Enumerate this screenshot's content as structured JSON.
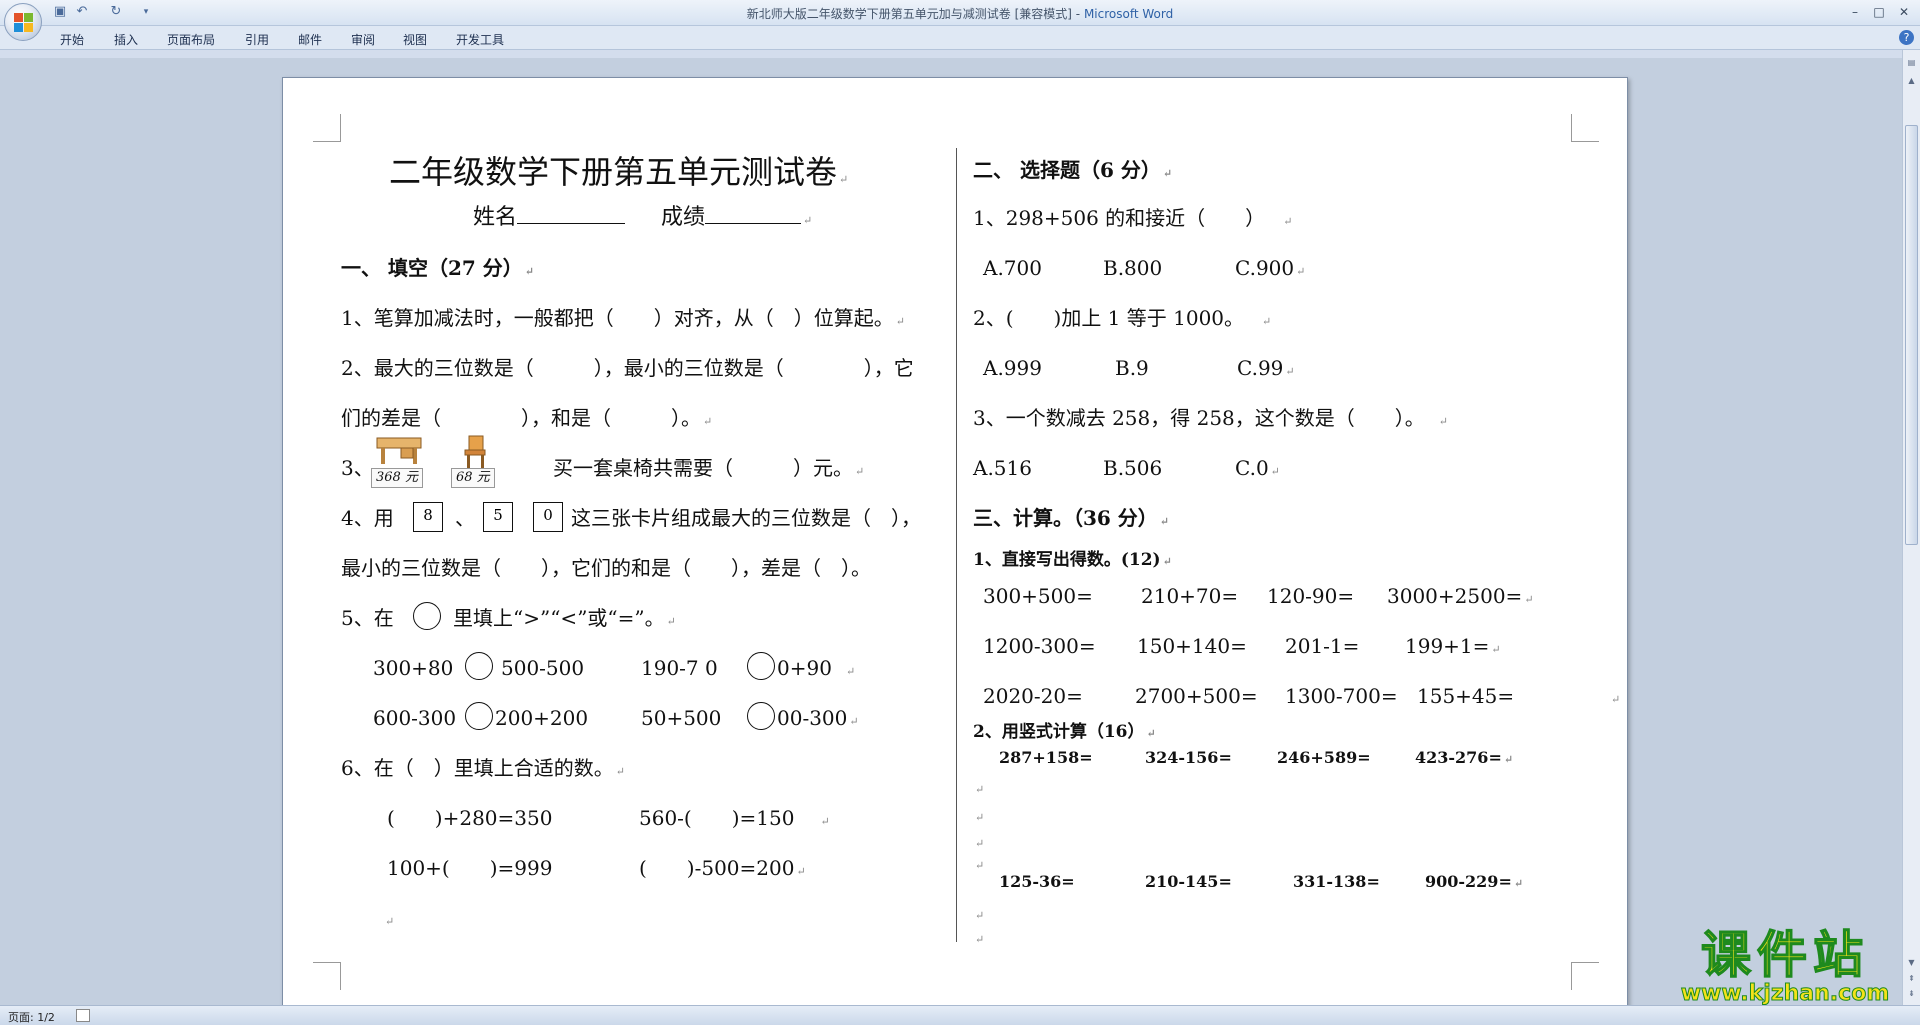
{
  "window": {
    "title": "新北师大版二年级数学下册第五单元加与减测试卷 [兼容模式]",
    "title_sep": " - ",
    "app_name": "Microsoft Word"
  },
  "ribbon": {
    "tabs": [
      "开始",
      "插入",
      "页面布局",
      "引用",
      "邮件",
      "审阅",
      "视图",
      "开发工具"
    ]
  },
  "doc": {
    "title": "二年级数学下册第五单元测试卷",
    "name_label": "姓名",
    "score_label": "成绩",
    "sec1": "一、 填空（27 分）",
    "q1": "1、笔算加减法时，一般都把（　　）对齐，从（　）位算起。",
    "q2a": "2、最大的三位数是（　　　），最小的三位数是（　　　　），它",
    "q2b": "们的差是（　　　　），和是（　　　）。",
    "q3_prefix": "3、",
    "q3_table_price": "368 元",
    "q3_chair_price": "68 元",
    "q3_text": "买一套桌椅共需要（　　　）元。",
    "q4_prefix": "4、用",
    "q4_cards": [
      "8",
      "5",
      "0"
    ],
    "q4_sep": "、",
    "q4_text": "这三张卡片组成最大的三位数是（　），",
    "q4b": "最小的三位数是（　　），它们的和是（　　），差是（　）。",
    "q5_prefix": "5、在",
    "q5_text": "里填上“>”“<”或“=”。",
    "q5_r1": [
      "300+80",
      "500-500",
      "190-7 0",
      "0+90"
    ],
    "q5_r2": [
      "600-300",
      "200+200",
      "50+500",
      "00-300"
    ],
    "q6": "6、在（　）里填上合适的数。",
    "q6_r1": [
      "(　　)+280=350",
      "560-(　　)=150"
    ],
    "q6_r2": [
      "100+(　　)=999",
      "(　　)-500=200"
    ],
    "sec2": "二、 选择题（6 分）",
    "c1": "1、298+506 的和接近（　　）",
    "c1_opts": [
      "A.700",
      "B.800",
      "C.900"
    ],
    "c2": "2、(　　)加上 1 等于 1000。",
    "c2_opts": [
      "A.999",
      "B.9",
      "C.99"
    ],
    "c3": "3、一个数减去 258，得 258，这个数是（　　）。",
    "c3_opts": [
      "A.516",
      "B.506",
      "C.0"
    ],
    "sec3": "三、计算。（36 分）",
    "calc1": "1、直接写出得数。(12)",
    "calc1_r1": [
      "300+500=",
      "210+70=",
      "120-90=",
      "3000+2500="
    ],
    "calc1_r2": [
      "1200-300=",
      "150+140=",
      "201-1=",
      "199+1="
    ],
    "calc1_r3": [
      "2020-20=",
      "2700+500=",
      "1300-700=",
      "155+45="
    ],
    "calc2": "2、用竖式计算（16）",
    "calc2_r1": [
      "287+158=",
      "324-156=",
      "246+589=",
      "423-276="
    ],
    "calc2_r2": [
      "125-36=",
      "210-145=",
      "331-138=",
      "900-229="
    ]
  },
  "status": {
    "page": "页面: 1/2"
  },
  "watermark": {
    "brand": "课件站",
    "url": "www.kjzhan.com"
  }
}
